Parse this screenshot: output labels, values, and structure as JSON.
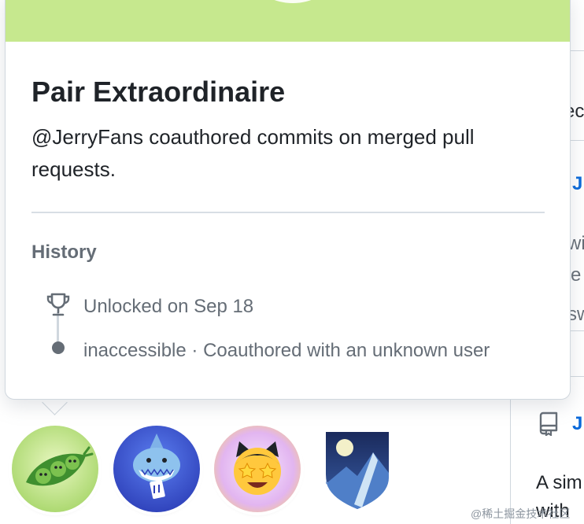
{
  "popover": {
    "title": "Pair Extraordinaire",
    "description": "@JerryFans coauthored commits on merged pull requests.",
    "history_heading": "History",
    "events": [
      {
        "icon": "trophy-icon",
        "text": "Unlocked on Sep 18"
      },
      {
        "icon": "dot-icon",
        "text": "inaccessible · Coauthored with an unknown user"
      }
    ],
    "banner_color": "#c6e88e"
  },
  "achievements": [
    {
      "name": "Pair Extraordinaire",
      "icon": "peapod-icon"
    },
    {
      "name": "shark",
      "icon": "shark-icon"
    },
    {
      "name": "star-struck",
      "icon": "starstruck-cat-icon"
    },
    {
      "name": "arctic",
      "icon": "mountain-shield-icon"
    }
  ],
  "background": {
    "fragments": [
      "ec",
      "J",
      "wi",
      "e",
      "sw",
      "J",
      "A sim",
      "with"
    ]
  },
  "watermark": "@稀土掘金技术社区"
}
